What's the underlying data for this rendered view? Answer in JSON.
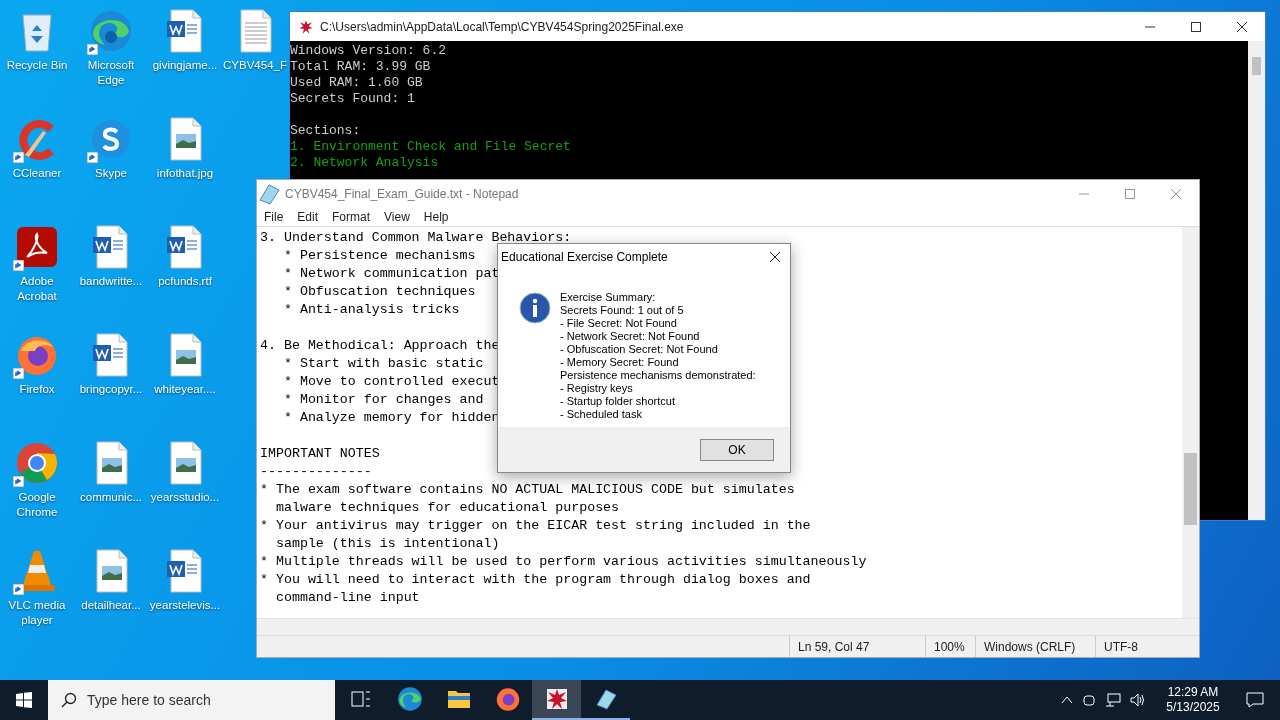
{
  "desktop_icons": [
    {
      "label": "Recycle Bin",
      "kind": "recycle",
      "shortcut": false
    },
    {
      "label": "CCleaner",
      "kind": "ccleaner",
      "shortcut": true
    },
    {
      "label": "Adobe Acrobat",
      "kind": "acrobat",
      "shortcut": true
    },
    {
      "label": "Firefox",
      "kind": "firefox",
      "shortcut": true
    },
    {
      "label": "Google Chrome",
      "kind": "chrome",
      "shortcut": true
    },
    {
      "label": "VLC media player",
      "kind": "vlc",
      "shortcut": true
    },
    {
      "label": "Microsoft Edge",
      "kind": "edge",
      "shortcut": true
    },
    {
      "label": "Skype",
      "kind": "skype",
      "shortcut": true
    },
    {
      "label": "bandwritte...",
      "kind": "word",
      "shortcut": false
    },
    {
      "label": "bringcopyr...",
      "kind": "word",
      "shortcut": false
    },
    {
      "label": "communic...",
      "kind": "image",
      "shortcut": false
    },
    {
      "label": "detailhear...",
      "kind": "image",
      "shortcut": false
    },
    {
      "label": "givingjame...",
      "kind": "word",
      "shortcut": false
    },
    {
      "label": "infothat.jpg",
      "kind": "image",
      "shortcut": false
    },
    {
      "label": "pcfunds.rtf",
      "kind": "word",
      "shortcut": false
    },
    {
      "label": "whiteyear....",
      "kind": "image",
      "shortcut": false
    },
    {
      "label": "yearsstudio...",
      "kind": "image",
      "shortcut": false
    },
    {
      "label": "yearstelevis...",
      "kind": "word",
      "shortcut": false
    },
    {
      "label": "CYBV454_F",
      "kind": "text",
      "shortcut": false
    }
  ],
  "console": {
    "title": "C:\\Users\\admin\\AppData\\Local\\Temp\\CYBV454Spring2025Final.exe",
    "lines": [
      {
        "text": "Windows Version: 6.2",
        "color": "#cccccc"
      },
      {
        "text": "Total RAM: 3.99 GB",
        "color": "#cccccc"
      },
      {
        "text": "Used RAM: 1.60 GB",
        "color": "#cccccc"
      },
      {
        "text": "Secrets Found: 1",
        "color": "#cccccc"
      },
      {
        "text": "Sections:",
        "color": "#cccccc",
        "gap_before": true
      },
      {
        "text": "1. Environment Check and File Secret",
        "color": "#13a10e"
      },
      {
        "text": "2. Network Analysis",
        "color": "#13a10e"
      }
    ]
  },
  "notepad": {
    "title": "CYBV454_Final_Exam_Guide.txt - Notepad",
    "menu": [
      "File",
      "Edit",
      "Format",
      "View",
      "Help"
    ],
    "blocks": [
      [
        "3. Understand Common Malware Behaviors:",
        "   * Persistence mechanisms",
        "   * Network communication pat",
        "   * Obfuscation techniques",
        "   * Anti-analysis tricks"
      ],
      [
        "4. Be Methodical: Approach the",
        "   * Start with basic static",
        "   * Move to controlled execut",
        "   * Monitor for changes and",
        "   * Analyze memory for hidden"
      ],
      [
        "IMPORTANT NOTES",
        "--------------",
        "* The exam software contains NO ACTUAL MALICIOUS CODE but simulates",
        "  malware techniques for educational purposes",
        "* Your antivirus may trigger on the EICAR test string included in the",
        "  sample (this is intentional)",
        "* Multiple threads will be used to perform various activities simultaneously",
        "* You will need to interact with the program through dialog boxes and",
        "  command-line input"
      ]
    ],
    "status": [
      "Ln 59, Col 47",
      "100%",
      "Windows (CRLF)",
      "UTF-8"
    ]
  },
  "dialog": {
    "title": "Educational Exercise Complete",
    "lines": [
      "Exercise Summary:",
      "Secrets Found: 1 out of 5",
      "- File Secret: Not Found",
      "- Network Secret: Not Found",
      "- Obfuscation Secret: Not Found",
      "- Memory Secret: Found",
      "Persistence mechanisms demonstrated:",
      "- Registry keys",
      "- Startup folder shortcut",
      "- Scheduled task"
    ],
    "button": "OK"
  },
  "taskbar": {
    "search": {
      "placeholder": "Type here to search"
    },
    "apps": [
      {
        "kind": "taskview",
        "selected": false,
        "running": false
      },
      {
        "kind": "edge",
        "selected": false,
        "running": false
      },
      {
        "kind": "explorer",
        "selected": false,
        "running": false
      },
      {
        "kind": "firefox",
        "selected": false,
        "running": false
      },
      {
        "kind": "console",
        "selected": true,
        "running": true
      },
      {
        "kind": "notepad",
        "selected": false,
        "running": true
      }
    ],
    "time": "12:29 AM",
    "date": "5/13/2025"
  }
}
